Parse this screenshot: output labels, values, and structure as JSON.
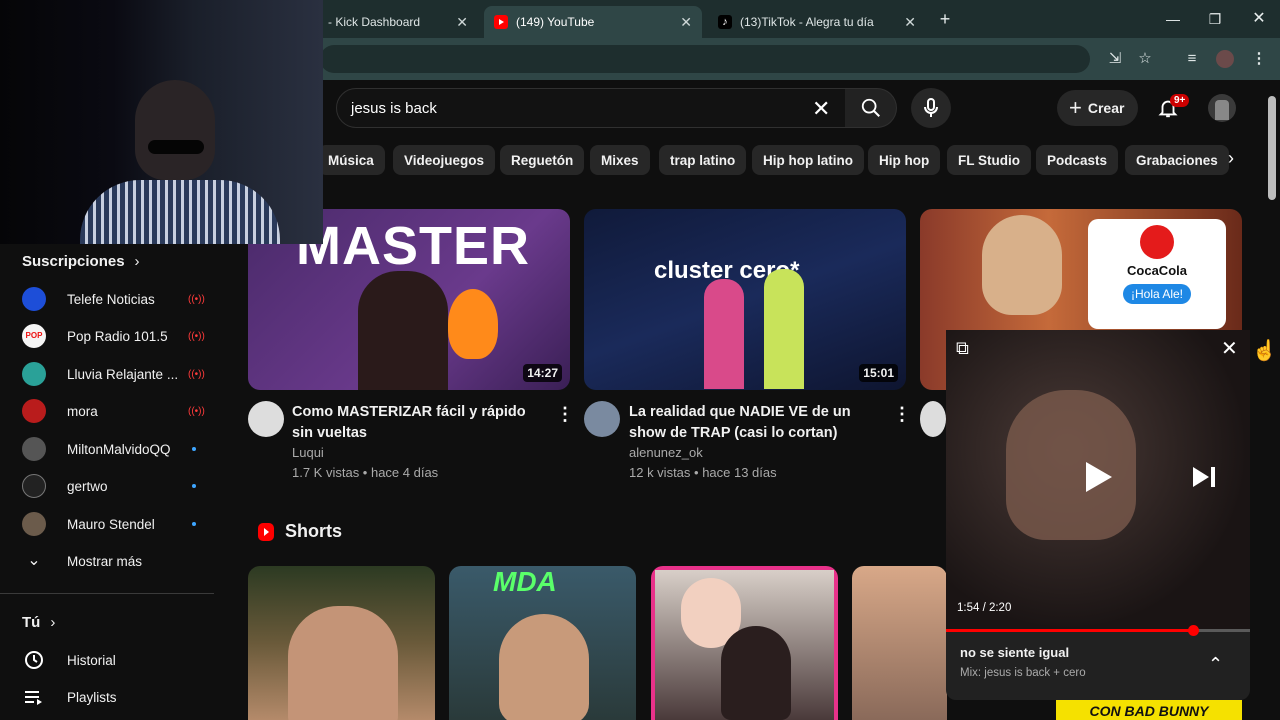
{
  "browser": {
    "tabs": [
      {
        "title": "- Kick Dashboard",
        "active": false
      },
      {
        "title": "(149) YouTube",
        "active": true
      },
      {
        "title": "(13)TikTok - Alegra tu día",
        "active": false
      }
    ],
    "new_tab": "+",
    "window_controls": [
      "minimize-icon",
      "restore-icon",
      "close-icon"
    ]
  },
  "header": {
    "search_query": "jesus is back",
    "create_label": "Crear",
    "notification_count": "9+"
  },
  "chips": [
    "Música",
    "Videojuegos",
    "Reguetón",
    "Mixes",
    "trap latino",
    "Hip hop latino",
    "Hip hop",
    "FL Studio",
    "Podcasts",
    "Grabaciones"
  ],
  "sidebar": {
    "subscriptions_title": "Suscripciones",
    "subscriptions": [
      {
        "name": "Telefe Noticias",
        "status": "live",
        "color": "#1d4ed8"
      },
      {
        "name": "Pop Radio 101.5",
        "status": "live",
        "color": "#f5f5f5"
      },
      {
        "name": "Lluvia Relajante ...",
        "status": "live",
        "color": "#2aa198"
      },
      {
        "name": "mora",
        "status": "live",
        "color": "#b91c1c"
      },
      {
        "name": "MiltonMalvidoQQ",
        "status": "new",
        "color": "#555555"
      },
      {
        "name": "gertwo",
        "status": "new",
        "color": "#222222"
      },
      {
        "name": "Mauro Stendel",
        "status": "new",
        "color": "#6b5b4b"
      }
    ],
    "show_more": "Mostrar más",
    "you_title": "Tú",
    "you_items": [
      {
        "label": "Historial",
        "icon": "history-icon"
      },
      {
        "label": "Playlists",
        "icon": "playlists-icon"
      }
    ]
  },
  "videos": [
    {
      "title": "Como MASTERIZAR fácil y rápido sin vueltas",
      "channel": "Luqui",
      "meta": "1.7 K vistas • hace 4 días",
      "duration": "14:27",
      "thumb_text": "MASTER"
    },
    {
      "title": "La realidad que NADIE VE de un show de TRAP (casi lo cortan)",
      "channel": "alenunez_ok",
      "meta": "12 k vistas • hace 13 días",
      "duration": "15:01",
      "thumb_text": "cluster cero*"
    },
    {
      "thumb_text": "CocaCola",
      "thumb_badge": "¡Hola Ale!"
    }
  ],
  "shorts": {
    "title": "Shorts",
    "items": [
      {
        "thumb_text": ""
      },
      {
        "thumb_text": "MDA"
      },
      {
        "thumb_text": ""
      },
      {
        "thumb_text": ""
      }
    ],
    "bottom_text": "CON BAD BUNNY"
  },
  "miniplayer": {
    "time": "1:54 / 2:20",
    "progress": 0.814,
    "title": "no se siente igual",
    "subtitle": "Mix: jesus is back + cero"
  },
  "colors": {
    "accent_red": "#ff0000",
    "background": "#0f0f0f",
    "chip_bg": "#272727",
    "browser_frame": "#1e2e2e"
  }
}
